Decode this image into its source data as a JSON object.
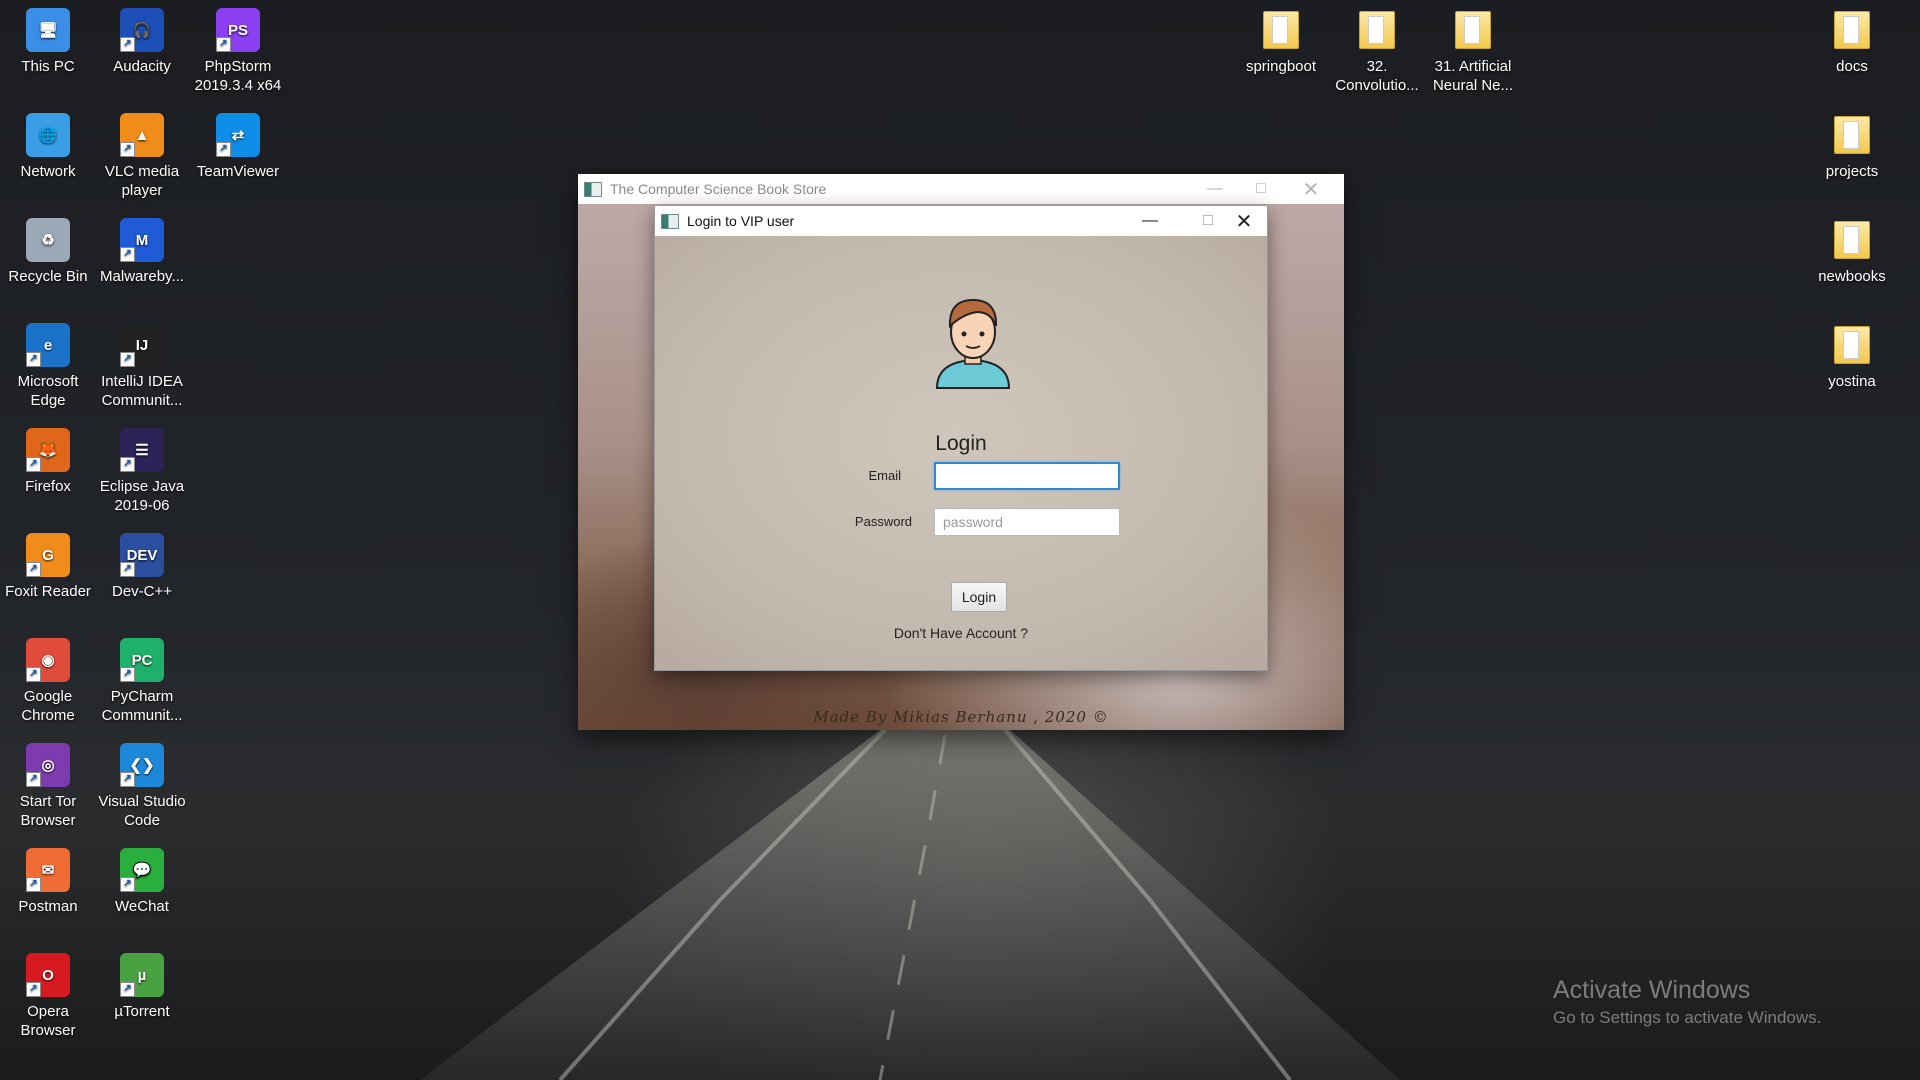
{
  "desktop": {
    "icons_left": [
      {
        "label": "This PC",
        "icon": "this-pc-icon"
      },
      {
        "label": "Audacity",
        "icon": "audacity-icon"
      },
      {
        "label": "PhpStorm 2019.3.4 x64",
        "icon": "phpstorm-icon"
      },
      {
        "label": "Network",
        "icon": "network-icon"
      },
      {
        "label": "VLC media player",
        "icon": "vlc-icon"
      },
      {
        "label": "TeamViewer",
        "icon": "teamviewer-icon"
      },
      {
        "label": "Recycle Bin",
        "icon": "recycle-bin-icon"
      },
      {
        "label": "Malwareby...",
        "icon": "malwarebytes-icon"
      },
      {
        "label": "Microsoft Edge",
        "icon": "edge-icon"
      },
      {
        "label": "IntelliJ IDEA Communit...",
        "icon": "intellij-icon"
      },
      {
        "label": "Firefox",
        "icon": "firefox-icon"
      },
      {
        "label": "Eclipse Java 2019-06",
        "icon": "eclipse-icon"
      },
      {
        "label": "Foxit Reader",
        "icon": "foxit-reader-icon"
      },
      {
        "label": "Dev-C++",
        "icon": "devcpp-icon"
      },
      {
        "label": "Google Chrome",
        "icon": "chrome-icon"
      },
      {
        "label": "PyCharm Communit...",
        "icon": "pycharm-icon"
      },
      {
        "label": "Start Tor Browser",
        "icon": "tor-browser-icon"
      },
      {
        "label": "Visual Studio Code",
        "icon": "vscode-icon"
      },
      {
        "label": "Postman",
        "icon": "postman-icon"
      },
      {
        "label": "WeChat",
        "icon": "wechat-icon"
      },
      {
        "label": "Opera Browser",
        "icon": "opera-icon"
      },
      {
        "label": "µTorrent",
        "icon": "utorrent-icon"
      }
    ],
    "icons_top": [
      {
        "label": "springboot",
        "icon": "folder-icon"
      },
      {
        "label": "32. Convolutio...",
        "icon": "folder-icon"
      },
      {
        "label": "31. Artificial Neural Ne...",
        "icon": "folder-icon"
      }
    ],
    "icons_right": [
      {
        "label": "docs",
        "icon": "folder-icon"
      },
      {
        "label": "projects",
        "icon": "folder-icon"
      },
      {
        "label": "newbooks",
        "icon": "folder-icon"
      },
      {
        "label": "yostina",
        "icon": "folder-icon"
      }
    ],
    "watermark": {
      "title": "Activate Windows",
      "subtitle": "Go to Settings to activate Windows."
    }
  },
  "main_window": {
    "title": "The Computer Science Book Store",
    "footer": "Made By Mikias Berhanu , 2020 ©"
  },
  "login_dialog": {
    "title": "Login to VIP user",
    "heading": "Login",
    "email_label": "Email",
    "email_value": "",
    "password_label": "Password",
    "password_placeholder": "password",
    "login_button": "Login",
    "signup_link": "Don't Have Account ?"
  },
  "colors": {
    "focus_border": "#2a8ad4",
    "desktop_bg": "#1f2124"
  }
}
